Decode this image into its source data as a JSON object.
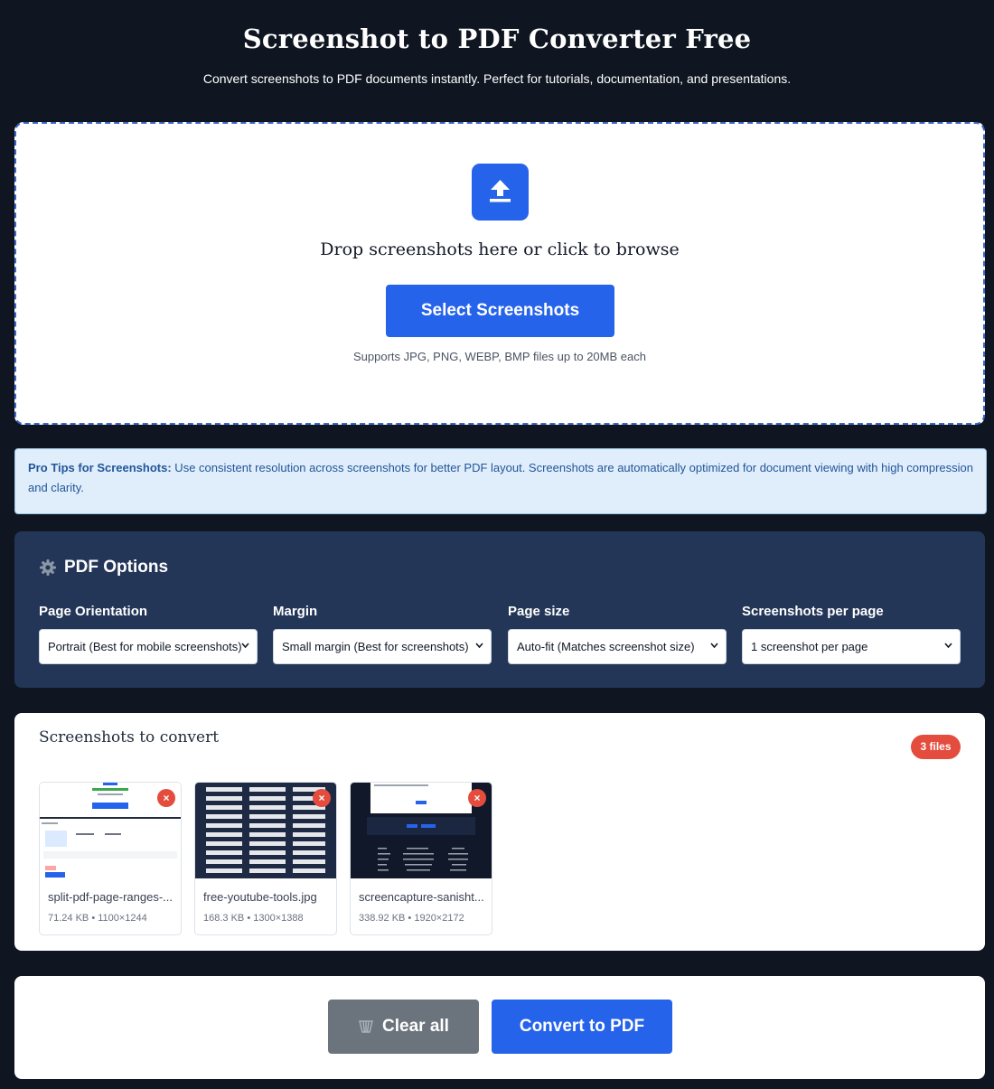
{
  "header": {
    "title": "Screenshot to PDF Converter Free",
    "subtitle": "Convert screenshots to PDF documents instantly. Perfect for tutorials, documentation, and presentations."
  },
  "dropzone": {
    "icon": "upload-icon",
    "text": "Drop screenshots here or click to browse",
    "button_label": "Select Screenshots",
    "supports": "Supports JPG, PNG, WEBP, BMP files up to 20MB each"
  },
  "tips": {
    "label": "Pro Tips for Screenshots:",
    "text": " Use consistent resolution across screenshots for better PDF layout. Screenshots are automatically optimized for document viewing with high compression and clarity."
  },
  "options": {
    "title": "PDF Options",
    "icon": "gear-icon",
    "fields": [
      {
        "label": "Page Orientation",
        "value": "Portrait (Best for mobile screenshots)"
      },
      {
        "label": "Margin",
        "value": "Small margin (Best for screenshots)"
      },
      {
        "label": "Page size",
        "value": "Auto-fit (Matches screenshot size)"
      },
      {
        "label": "Screenshots per page",
        "value": "1 screenshot per page"
      }
    ]
  },
  "screenshots": {
    "title": "Screenshots to convert",
    "badge": "3 files",
    "files": [
      {
        "name": "split-pdf-page-ranges-...",
        "meta": "71.24 KB • 1100×1244"
      },
      {
        "name": "free-youtube-tools.jpg",
        "meta": "168.3 KB • 1300×1388"
      },
      {
        "name": "screencapture-sanisht...",
        "meta": "338.92 KB • 1920×2172"
      }
    ],
    "remove_label": "×"
  },
  "actions": {
    "clear_label": "Clear all",
    "convert_label": "Convert to PDF"
  },
  "colors": {
    "background": "#0f1621",
    "accent": "#2563eb",
    "options_panel": "#243658",
    "badge": "#e44c3e",
    "clear_button": "#6b747c",
    "tips_bg": "#e0eefb"
  }
}
